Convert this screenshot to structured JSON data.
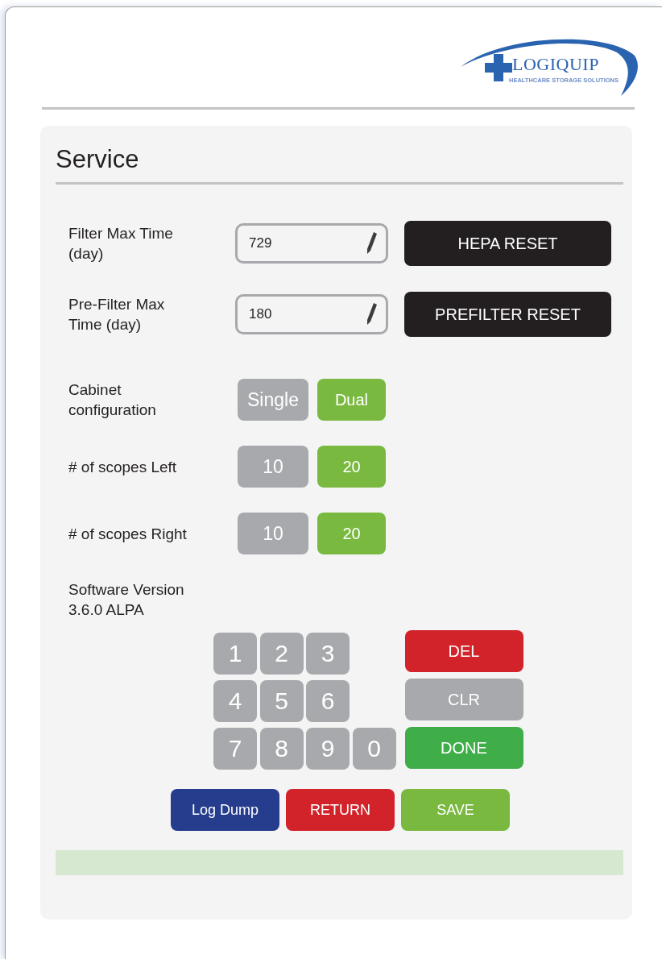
{
  "logo": {
    "name": "LOGIQUIP",
    "tagline": "HEALTHCARE STORAGE SOLUTIONS"
  },
  "title": "Service",
  "filters": [
    {
      "label": "Filter Max Time (day)",
      "value": "729",
      "button": "HEPA RESET"
    },
    {
      "label": "Pre-Filter Max Time (day)",
      "value": "180",
      "button": "PREFILTER RESET"
    }
  ],
  "toggles": [
    {
      "label": "Cabinet configuration",
      "options": [
        {
          "label": "Single",
          "selected": false
        },
        {
          "label": "Dual",
          "selected": true
        }
      ]
    },
    {
      "label": "# of scopes Left",
      "options": [
        {
          "label": "10",
          "selected": false
        },
        {
          "label": "20",
          "selected": true
        }
      ]
    },
    {
      "label": "# of scopes Right",
      "options": [
        {
          "label": "10",
          "selected": false
        },
        {
          "label": "20",
          "selected": true
        }
      ]
    }
  ],
  "software_version": "Software Version 3.6.0 ALPA",
  "keypad": [
    "1",
    "2",
    "3",
    "4",
    "5",
    "6",
    "7",
    "8",
    "9",
    "0"
  ],
  "keypad_actions": [
    {
      "label": "DEL",
      "kind": "danger"
    },
    {
      "label": "CLR",
      "kind": "neutral"
    },
    {
      "label": "DONE",
      "kind": "confirm"
    }
  ],
  "bottom_buttons": [
    {
      "label": "Log Dump",
      "kind": "primary"
    },
    {
      "label": "RETURN",
      "kind": "danger"
    },
    {
      "label": "SAVE",
      "kind": "save"
    }
  ]
}
